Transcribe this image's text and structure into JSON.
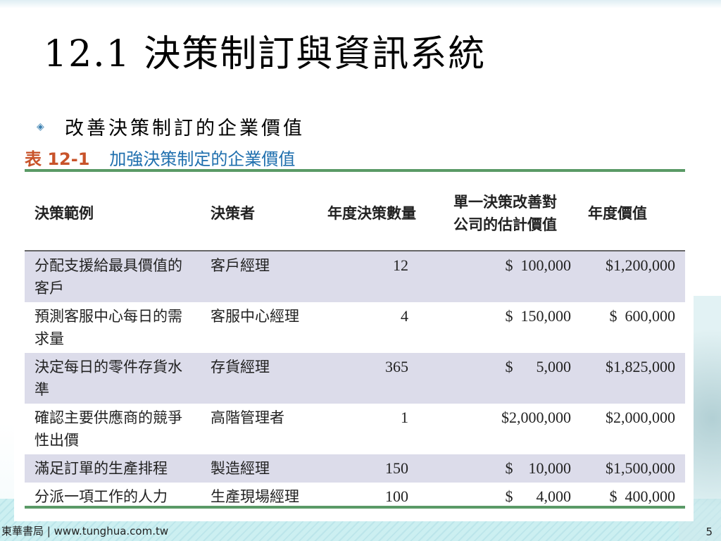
{
  "title": "12.1 決策制訂與資訊系統",
  "bullet": "改善決策制訂的企業價值",
  "table": {
    "number": "表 12-1",
    "caption": "加強決策制定的企業價值",
    "headers": [
      "決策範例",
      "決策者",
      "年度決策數量",
      "單一決策改善對公司的估計價值",
      "年度價值"
    ],
    "rows": [
      [
        "分配支援給最具價值的客戶",
        "客戶經理",
        "12",
        "$  100,000",
        "$1,200,000"
      ],
      [
        "預測客服中心每日的需求量",
        "客服中心經理",
        "4",
        "$  150,000",
        "$  600,000"
      ],
      [
        "決定每日的零件存貨水準",
        "存貨經理",
        "365",
        "$      5,000",
        "$1,825,000"
      ],
      [
        "確認主要供應商的競爭性出價",
        "高階管理者",
        "1",
        "$2,000,000",
        "$2,000,000"
      ],
      [
        "滿足訂單的生產排程",
        "製造經理",
        "150",
        "$    10,000",
        "$1,500,000"
      ],
      [
        "分派一項工作的人力",
        "生產現場經理",
        "100",
        "$      4,000",
        "$  400,000"
      ]
    ]
  },
  "footer": "東華書局 | www.tunghua.com.tw",
  "page_number": "5"
}
